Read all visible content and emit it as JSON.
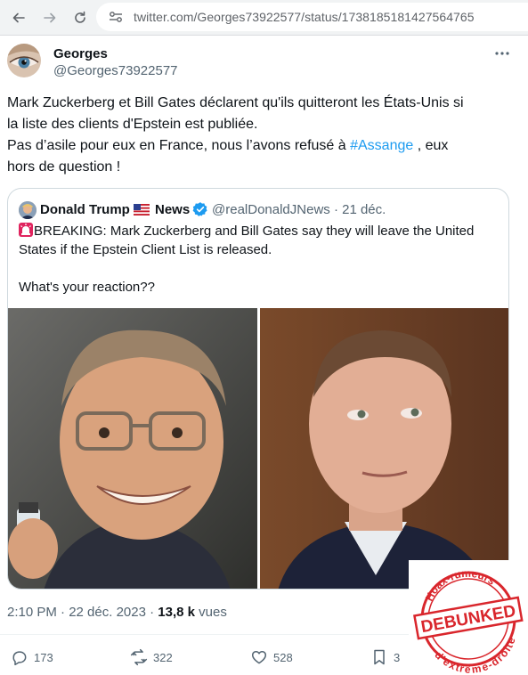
{
  "browser": {
    "url": "twitter.com/Georges73922577/status/1738185181427564765"
  },
  "tweet": {
    "author_name": "Georges",
    "author_handle": "@Georges73922577",
    "text_lines": [
      "Mark Zuckerberg et Bill Gates déclarent qu'ils quitteront les États-Unis si",
      "la liste des clients d'Epstein est publiée.",
      "Pas d’asile pour eux en France, nous l’avons refusé à "
    ],
    "hashtag": "#Assange",
    "text_after_hashtag": " , eux",
    "text_last_line": "hors de question !",
    "time": "2:10 PM · 22 déc. 2023",
    "views_count": "13,8 k",
    "views_label": " vues"
  },
  "quote": {
    "name": "Donald Trump",
    "news_label": "News",
    "handle_date": "@realDonaldJNews · 21 déc.",
    "text_line1": "BREAKING: Mark Zuckerberg and Bill Gates say they will leave the United",
    "text_line2": "States if the Epstein Client List is released.",
    "text_line3": "What's your reaction??"
  },
  "actions": {
    "replies": "173",
    "retweets": "322",
    "likes": "528",
    "bookmarks": "3"
  },
  "stamp": {
    "top_text": "Hoax-rumeurs",
    "main_text": "DEBUNKED",
    "bottom_text": "d'extrême-droite"
  },
  "colors": {
    "link": "#1d9bf0",
    "secondary_text": "#536471",
    "stamp_red": "#d9262c"
  },
  "icons": [
    "back-arrow-icon",
    "forward-arrow-icon",
    "reload-icon",
    "site-settings-icon",
    "more-icon",
    "verified-badge-icon",
    "us-flag-icon",
    "alarm-light-icon",
    "reply-icon",
    "retweet-icon",
    "like-icon",
    "bookmark-icon"
  ]
}
